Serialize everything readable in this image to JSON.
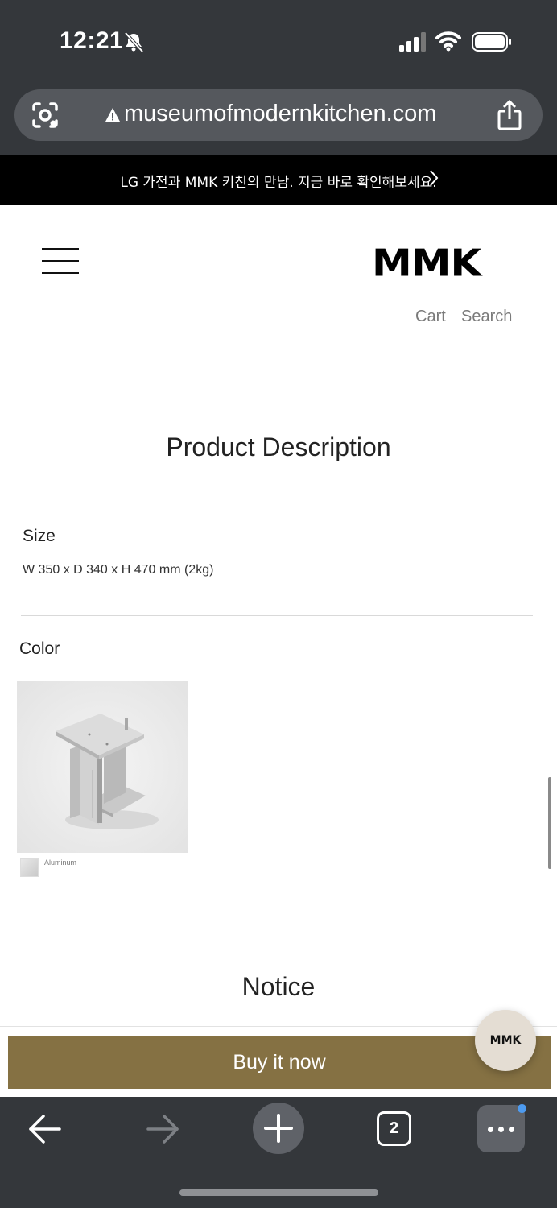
{
  "status_bar": {
    "time": "12:21"
  },
  "browser": {
    "url": "museumofmodernkitchen.com",
    "tab_count": "2"
  },
  "announcement": {
    "text": "LG 가전과 MMK 키친의 만남. 지금 바로 확인해보세요."
  },
  "header": {
    "logo": "MMK",
    "nav": {
      "cart": "Cart",
      "search": "Search"
    }
  },
  "content": {
    "description_title": "Product Description",
    "size": {
      "label": "Size",
      "value": "W 350 x D 340 x H 470 mm (2kg)"
    },
    "color": {
      "label": "Color",
      "options": [
        {
          "name": "Aluminum"
        }
      ]
    },
    "notice_title": "Notice"
  },
  "actions": {
    "buy_now": "Buy it now",
    "fab_label": "MMK"
  },
  "colors": {
    "buy_button": "#857143",
    "chrome": "#34373b",
    "fab": "#e4ddd3"
  }
}
